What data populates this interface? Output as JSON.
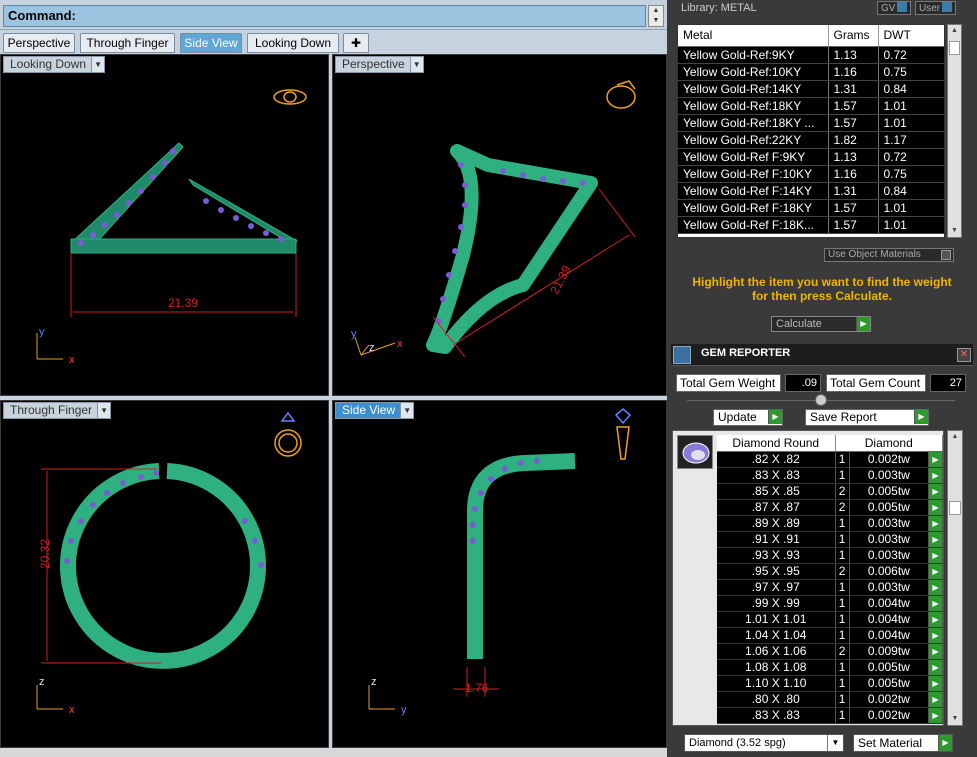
{
  "command": {
    "label": "Command:"
  },
  "tabs": [
    {
      "label": "Perspective"
    },
    {
      "label": "Through Finger"
    },
    {
      "label": "Side View",
      "active": true
    },
    {
      "label": "Looking Down"
    },
    {
      "label": "✚"
    }
  ],
  "viewports": {
    "top_left": {
      "label": "Looking Down",
      "dimension": "21.39",
      "axis_v": "y",
      "axis_h": "x"
    },
    "top_right": {
      "label": "Perspective",
      "dimension": "21.39",
      "axis_v": "y",
      "axis_h": "x",
      "axis_z": "z"
    },
    "bottom_left": {
      "label": "Through Finger",
      "dimension": "20.32",
      "axis_v": "z",
      "axis_h": "x"
    },
    "bottom_right": {
      "label": "Side View",
      "dimension": "1.76",
      "axis_v": "z",
      "axis_h": "y"
    }
  },
  "library": {
    "title": "Library: METAL",
    "gv_label": "GV",
    "user_label": "User",
    "columns": [
      "Metal",
      "Grams",
      "DWT"
    ],
    "rows": [
      [
        "Yellow Gold-Ref:9KY",
        "1.13",
        "0.72"
      ],
      [
        "Yellow Gold-Ref:10KY",
        "1.16",
        "0.75"
      ],
      [
        "Yellow Gold-Ref:14KY",
        "1.31",
        "0.84"
      ],
      [
        "Yellow Gold-Ref:18KY",
        "1.57",
        "1.01"
      ],
      [
        "Yellow Gold-Ref:18KY ...",
        "1.57",
        "1.01"
      ],
      [
        "Yellow Gold-Ref:22KY",
        "1.82",
        "1.17"
      ],
      [
        "Yellow Gold-Ref F:9KY",
        "1.13",
        "0.72"
      ],
      [
        "Yellow Gold-Ref F:10KY",
        "1.16",
        "0.75"
      ],
      [
        "Yellow Gold-Ref F:14KY",
        "1.31",
        "0.84"
      ],
      [
        "Yellow Gold-Ref F:18KY",
        "1.57",
        "1.01"
      ],
      [
        "Yellow Gold-Ref F:18K...",
        "1.57",
        "1.01"
      ]
    ],
    "use_object_materials": "Use Object Materials",
    "instruction": "Highlight the item you want to find the weight for then press Calculate.",
    "calculate_label": "Calculate"
  },
  "gem_reporter": {
    "title": "GEM REPORTER",
    "total_weight_label": "Total Gem Weight",
    "total_weight": ".09",
    "total_count_label": "Total Gem Count",
    "total_count": "27",
    "update_label": "Update",
    "save_report_label": "Save Report",
    "columns": [
      "Diamond Round",
      "Diamond"
    ],
    "rows": [
      [
        ".82 X .82",
        "1",
        "0.002tw"
      ],
      [
        ".83 X .83",
        "1",
        "0.003tw"
      ],
      [
        ".85 X .85",
        "2",
        "0.005tw"
      ],
      [
        ".87 X .87",
        "2",
        "0.005tw"
      ],
      [
        ".89 X .89",
        "1",
        "0.003tw"
      ],
      [
        ".91 X .91",
        "1",
        "0.003tw"
      ],
      [
        ".93 X .93",
        "1",
        "0.003tw"
      ],
      [
        ".95 X .95",
        "2",
        "0.006tw"
      ],
      [
        ".97 X .97",
        "1",
        "0.003tw"
      ],
      [
        ".99 X .99",
        "1",
        "0.004tw"
      ],
      [
        "1.01 X 1.01",
        "1",
        "0.004tw"
      ],
      [
        "1.04 X 1.04",
        "1",
        "0.004tw"
      ],
      [
        "1.06 X 1.06",
        "2",
        "0.009tw"
      ],
      [
        "1.08 X 1.08",
        "1",
        "0.005tw"
      ],
      [
        "1.10 X 1.10",
        "1",
        "0.005tw"
      ],
      [
        ".80 X .80",
        "1",
        "0.002tw"
      ],
      [
        ".83 X .83",
        "1",
        "0.002tw"
      ]
    ],
    "material_select": "Diamond     (3.52 spg)",
    "set_material_label": "Set Material"
  }
}
